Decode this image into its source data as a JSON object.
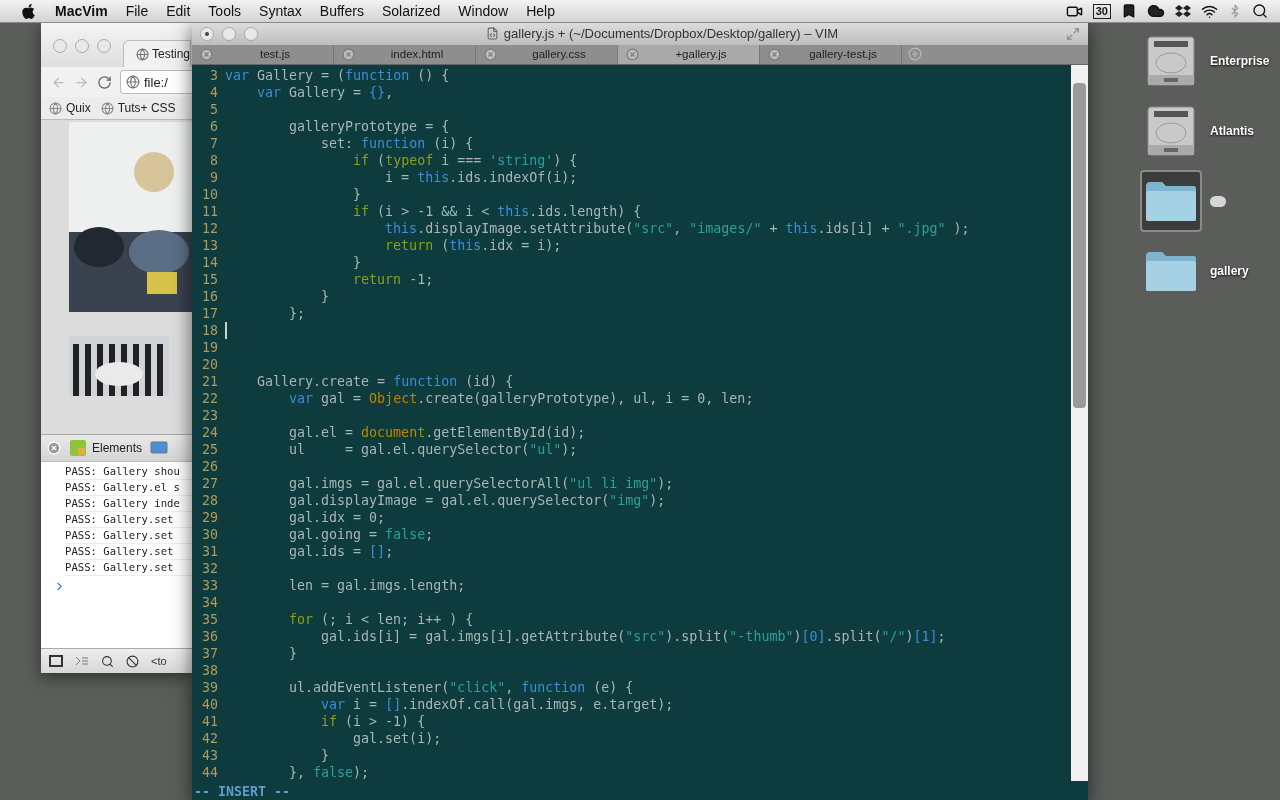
{
  "menu_bar": {
    "app": "MacVim",
    "menus": [
      "File",
      "Edit",
      "Tools",
      "Syntax",
      "Buffers",
      "Solarized",
      "Window",
      "Help"
    ],
    "calendar_day": "30"
  },
  "browser": {
    "tab": "Testing",
    "address": "file:/",
    "bookmarks": [
      "Quix",
      "Tuts+ CSS"
    ],
    "devtools_tab": "Elements",
    "console": [
      "PASS: Gallery shou",
      "PASS: Gallery.el s",
      "PASS: Gallery inde",
      "PASS: Gallery.set",
      "PASS: Gallery.set",
      "PASS: Gallery.set",
      "PASS: Gallery.set"
    ],
    "breadcrumb": "<to"
  },
  "vim": {
    "title": "gallery.js + (~/Documents/Dropbox/Desktop/gallery) – VIM",
    "tabs": [
      {
        "label": "test.js",
        "selected": false
      },
      {
        "label": "index.html",
        "selected": false
      },
      {
        "label": "gallery.css",
        "selected": false
      },
      {
        "label": "+gallery.js",
        "selected": true
      },
      {
        "label": "gallery-test.js",
        "selected": false
      }
    ],
    "lines": [
      {
        "number": "3",
        "cursor": false,
        "tokens": [
          {
            "kind": "keyword",
            "text": "var"
          },
          " Gallery = (",
          {
            "kind": "keyword",
            "text": "function"
          },
          " () {"
        ]
      },
      {
        "number": "4",
        "cursor": false,
        "tokens": [
          {
            "kind": "keyword",
            "text": "    var"
          },
          " Gallery = ",
          {
            "kind": "bracket",
            "text": "{}"
          },
          ","
        ]
      },
      {
        "number": "5",
        "cursor": false
      },
      {
        "number": "6",
        "cursor": false,
        "tokens": [
          "        galleryPrototype = {"
        ]
      },
      {
        "number": "7",
        "cursor": false,
        "tokens": [
          "            set: ",
          {
            "kind": "keyword",
            "text": "function"
          },
          " (i) {"
        ]
      },
      {
        "number": "8",
        "cursor": false,
        "tokens": [
          {
            "kind": "control",
            "text": "                if"
          },
          " (",
          {
            "kind": "control",
            "text": "typeof"
          },
          " i === ",
          {
            "kind": "string",
            "text": "'string'"
          },
          ") {"
        ]
      },
      {
        "number": "9",
        "cursor": false,
        "tokens": [
          "                    i = ",
          {
            "kind": "keyword",
            "text": "this"
          },
          ".ids.indexOf(i);"
        ]
      },
      {
        "number": "10",
        "cursor": false,
        "tokens": [
          "                }"
        ]
      },
      {
        "number": "11",
        "cursor": false,
        "tokens": [
          {
            "kind": "control",
            "text": "                if"
          },
          " (i > -1 && i < ",
          {
            "kind": "keyword",
            "text": "this"
          },
          ".ids.length) {"
        ]
      },
      {
        "number": "12",
        "cursor": false,
        "tokens": [
          {
            "kind": "keyword",
            "text": "                    this"
          },
          ".displayImage.setAttribute(",
          {
            "kind": "string",
            "text": "\"src\""
          },
          ", ",
          {
            "kind": "string",
            "text": "\"images/\""
          },
          " + ",
          {
            "kind": "keyword",
            "text": "this"
          },
          ".ids[i] + ",
          {
            "kind": "string",
            "text": "\".jpg\""
          },
          " );"
        ]
      },
      {
        "number": "13",
        "cursor": false,
        "tokens": [
          {
            "kind": "control",
            "text": "                    return"
          },
          " (",
          {
            "kind": "keyword",
            "text": "this"
          },
          ".idx = i);"
        ]
      },
      {
        "number": "14",
        "cursor": false,
        "tokens": [
          "                }"
        ]
      },
      {
        "number": "15",
        "cursor": false,
        "tokens": [
          {
            "kind": "control",
            "text": "                return"
          },
          " -1;"
        ]
      },
      {
        "number": "16",
        "cursor": false,
        "tokens": [
          "            }"
        ]
      },
      {
        "number": "17",
        "cursor": false,
        "tokens": [
          "        };"
        ]
      },
      {
        "number": "18",
        "cursor": true
      },
      {
        "number": "19",
        "cursor": false
      },
      {
        "number": "20",
        "cursor": false
      },
      {
        "number": "21",
        "cursor": false,
        "tokens": [
          "    Gallery.create = ",
          {
            "kind": "keyword",
            "text": "function"
          },
          " (id) {"
        ]
      },
      {
        "number": "22",
        "cursor": false,
        "tokens": [
          {
            "kind": "keyword",
            "text": "        var"
          },
          " gal = ",
          {
            "kind": "builtin",
            "text": "Object"
          },
          ".create(galleryPrototype), ul, i = 0, len;"
        ]
      },
      {
        "number": "23",
        "cursor": false
      },
      {
        "number": "24",
        "cursor": false,
        "tokens": [
          "        gal.el = ",
          {
            "kind": "builtin",
            "text": "document"
          },
          ".getElementById(id);"
        ]
      },
      {
        "number": "25",
        "cursor": false,
        "tokens": [
          "        ul     = gal.el.querySelector(",
          {
            "kind": "string",
            "text": "\"ul\""
          },
          ");"
        ]
      },
      {
        "number": "26",
        "cursor": false
      },
      {
        "number": "27",
        "cursor": false,
        "tokens": [
          "        gal.imgs = gal.el.querySelectorAll(",
          {
            "kind": "string",
            "text": "\"ul li img\""
          },
          ");"
        ]
      },
      {
        "number": "28",
        "cursor": false,
        "tokens": [
          "        gal.displayImage = gal.el.querySelector(",
          {
            "kind": "string",
            "text": "\"img\""
          },
          ");"
        ]
      },
      {
        "number": "29",
        "cursor": false,
        "tokens": [
          "        gal.idx = 0;"
        ]
      },
      {
        "number": "30",
        "cursor": false,
        "tokens": [
          "        gal.going = ",
          {
            "kind": "literal",
            "text": "false"
          },
          ";"
        ]
      },
      {
        "number": "31",
        "cursor": false,
        "tokens": [
          "        gal.ids = ",
          {
            "kind": "bracket",
            "text": "[]"
          },
          ";"
        ]
      },
      {
        "number": "32",
        "cursor": false
      },
      {
        "number": "33",
        "cursor": false,
        "tokens": [
          "        len = gal.imgs.length;"
        ]
      },
      {
        "number": "34",
        "cursor": false
      },
      {
        "number": "35",
        "cursor": false,
        "tokens": [
          {
            "kind": "control",
            "text": "        for"
          },
          " (; i < len; i++ ) {"
        ]
      },
      {
        "number": "36",
        "cursor": false,
        "tokens": [
          "            gal.ids[i] = gal.imgs[i].getAttribute(",
          {
            "kind": "string",
            "text": "\"src\""
          },
          ").split(",
          {
            "kind": "string",
            "text": "\"-thumb\""
          },
          ")",
          {
            "kind": "bracket",
            "text": "[0]"
          },
          ".split(",
          {
            "kind": "string",
            "text": "\"/\""
          },
          ")",
          {
            "kind": "bracket",
            "text": "[1]"
          },
          ";"
        ]
      },
      {
        "number": "37",
        "cursor": false,
        "tokens": [
          "        }"
        ]
      },
      {
        "number": "38",
        "cursor": false
      },
      {
        "number": "39",
        "cursor": false,
        "tokens": [
          "        ul.addEventListener(",
          {
            "kind": "string",
            "text": "\"click\""
          },
          ", ",
          {
            "kind": "keyword",
            "text": "function"
          },
          " (e) {"
        ]
      },
      {
        "number": "40",
        "cursor": false,
        "tokens": [
          {
            "kind": "keyword",
            "text": "            var"
          },
          " i = ",
          {
            "kind": "bracket",
            "text": "[]"
          },
          ".indexOf.call(gal.imgs, e.target);"
        ]
      },
      {
        "number": "41",
        "cursor": false,
        "tokens": [
          {
            "kind": "control",
            "text": "            if"
          },
          " (i > -1) {"
        ]
      },
      {
        "number": "42",
        "cursor": false,
        "tokens": [
          "                gal.set(i);"
        ]
      },
      {
        "number": "43",
        "cursor": false,
        "tokens": [
          "            }"
        ]
      },
      {
        "number": "44",
        "cursor": false,
        "tokens": [
          "        }, ",
          {
            "kind": "literal",
            "text": "false"
          },
          ");"
        ]
      }
    ],
    "mode": "-- INSERT --"
  },
  "desktop_icons": [
    {
      "kind": "drive",
      "label": "Enterprise",
      "selected": false
    },
    {
      "kind": "drive",
      "label": "Atlantis",
      "selected": false
    },
    {
      "kind": "folder",
      "selected": true
    },
    {
      "kind": "folder",
      "label": "gallery",
      "selected": false
    }
  ]
}
